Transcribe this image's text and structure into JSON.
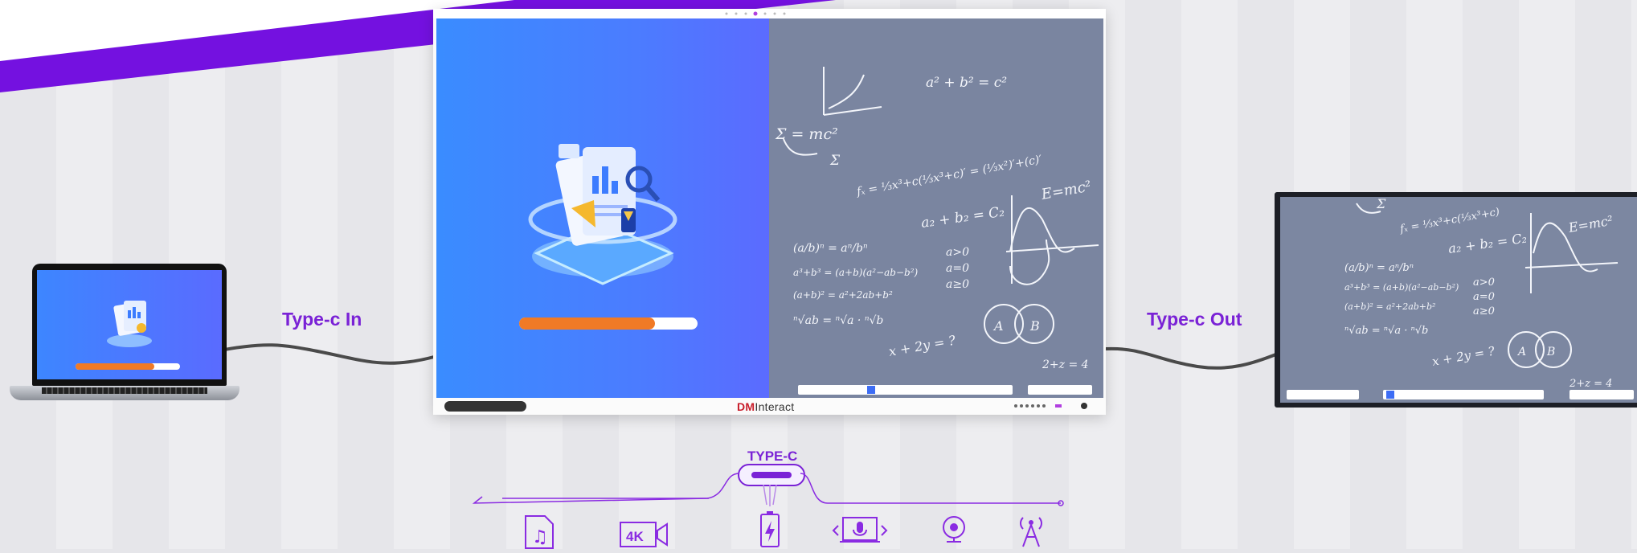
{
  "labels": {
    "type_c_in": "Type-c In",
    "type_c_out": "Type-c Out",
    "type_c": "TYPE-C"
  },
  "board": {
    "brand_prefix": "DM",
    "brand_suffix": "Interact"
  },
  "icons": {
    "bottom_row": [
      "music-file-icon",
      "4k-camera-icon",
      "charging-battery-icon",
      "laptop-microphone-icon",
      "webcam-icon",
      "antenna-icon"
    ],
    "video_4k_label": "4K"
  },
  "colors": {
    "accent_purple": "#7a22d6",
    "progress_orange": "#f07a26",
    "screen_blue": "#3a8cff",
    "chalkboard_gray": "#7a85a0"
  },
  "progress": {
    "main_fraction": 0.76,
    "laptop_fraction": 0.75
  }
}
